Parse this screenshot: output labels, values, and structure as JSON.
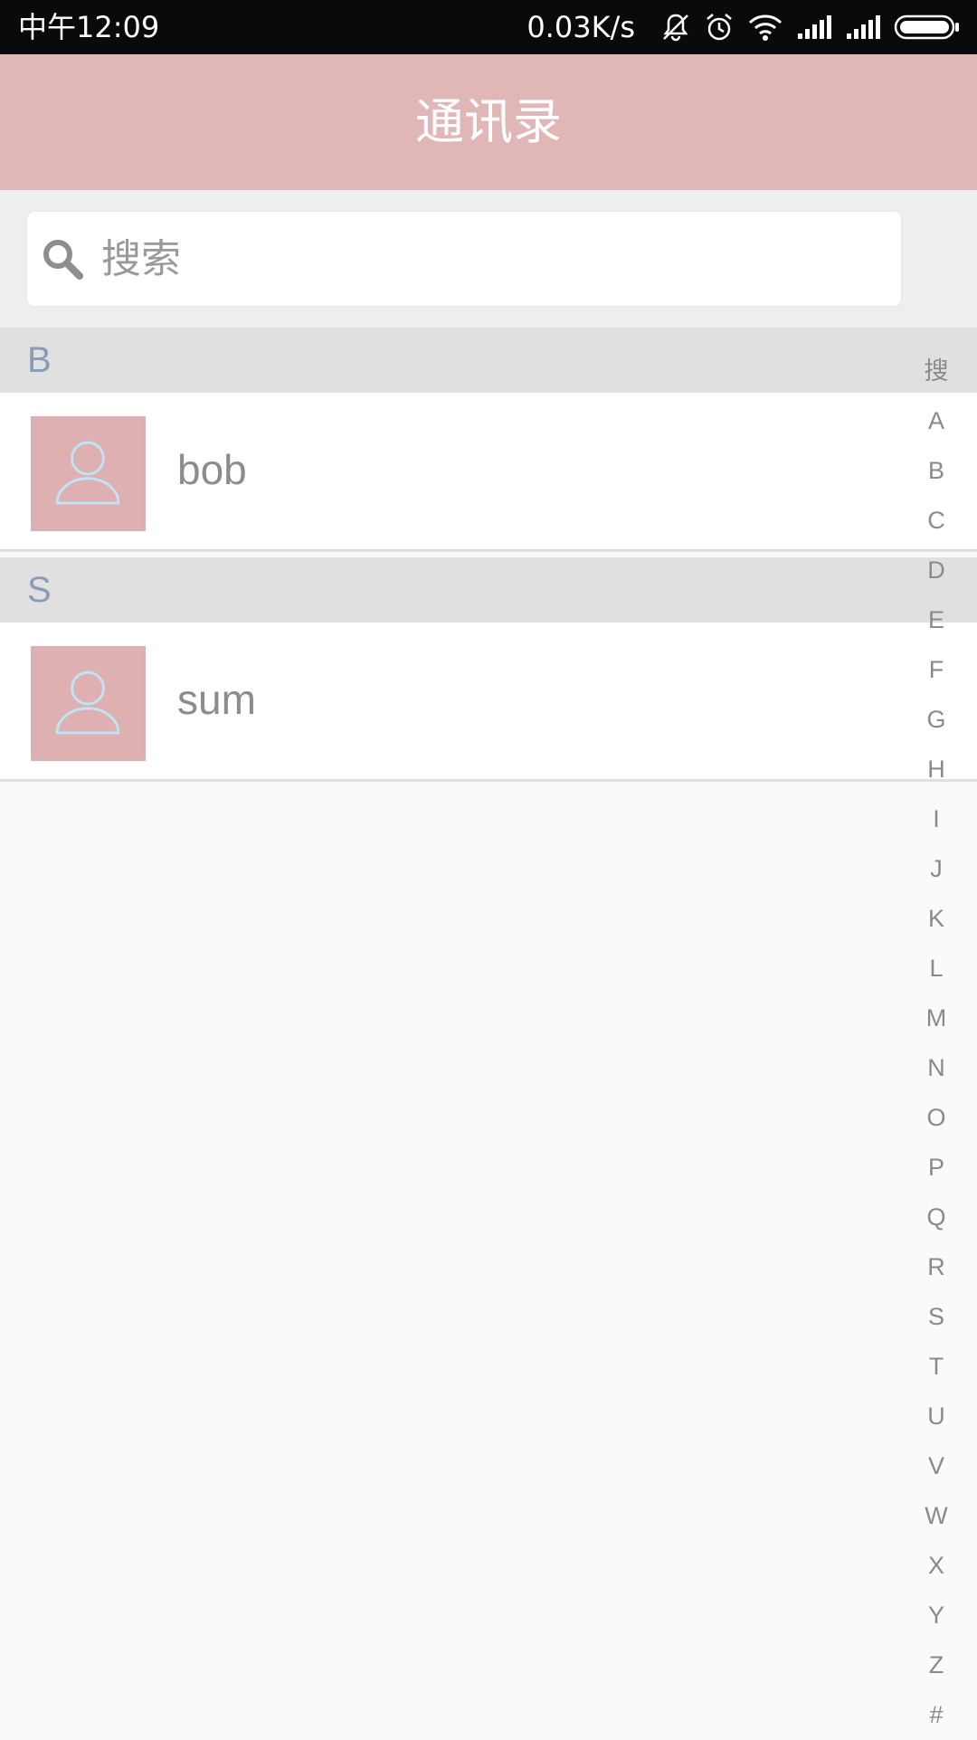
{
  "status_bar": {
    "time": "中午12:09",
    "network_speed": "0.03K/s",
    "icons": [
      "bell-off-icon",
      "alarm-icon",
      "wifi-icon",
      "signal-icon",
      "signal-icon",
      "battery-icon"
    ]
  },
  "header": {
    "title": "通讯录",
    "background_color": "#e1b6b7"
  },
  "search": {
    "icon": "search-icon",
    "placeholder": "搜索",
    "value": ""
  },
  "contacts": {
    "sections": [
      {
        "letter": "B",
        "items": [
          {
            "name": "bob",
            "avatar_icon": "person-icon"
          }
        ]
      },
      {
        "letter": "S",
        "items": [
          {
            "name": "sum",
            "avatar_icon": "person-icon"
          }
        ]
      }
    ]
  },
  "alphabet_index": [
    "搜",
    "A",
    "B",
    "C",
    "D",
    "E",
    "F",
    "G",
    "H",
    "I",
    "J",
    "K",
    "L",
    "M",
    "N",
    "O",
    "P",
    "Q",
    "R",
    "S",
    "T",
    "U",
    "V",
    "W",
    "X",
    "Y",
    "Z",
    "#"
  ]
}
